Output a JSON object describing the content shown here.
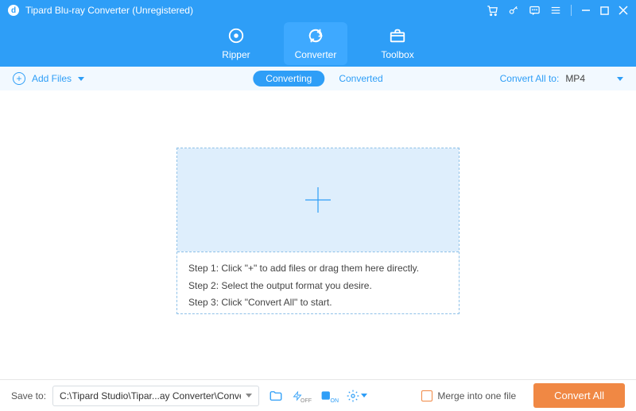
{
  "titlebar": {
    "logo_letter": "d",
    "title": "Tipard Blu-ray Converter (Unregistered)"
  },
  "nav": {
    "ripper": "Ripper",
    "converter": "Converter",
    "toolbox": "Toolbox"
  },
  "subbar": {
    "add_files": "Add Files",
    "converting": "Converting",
    "converted": "Converted",
    "convert_all_to": "Convert All to:",
    "format": "MP4"
  },
  "steps": {
    "s1": "Step 1: Click \"+\" to add files or drag them here directly.",
    "s2": "Step 2: Select the output format you desire.",
    "s3": "Step 3: Click \"Convert All\" to start."
  },
  "footer": {
    "save_to": "Save to:",
    "path": "C:\\Tipard Studio\\Tipar...ay Converter\\Converted",
    "merge": "Merge into one file",
    "convert_all": "Convert All"
  }
}
